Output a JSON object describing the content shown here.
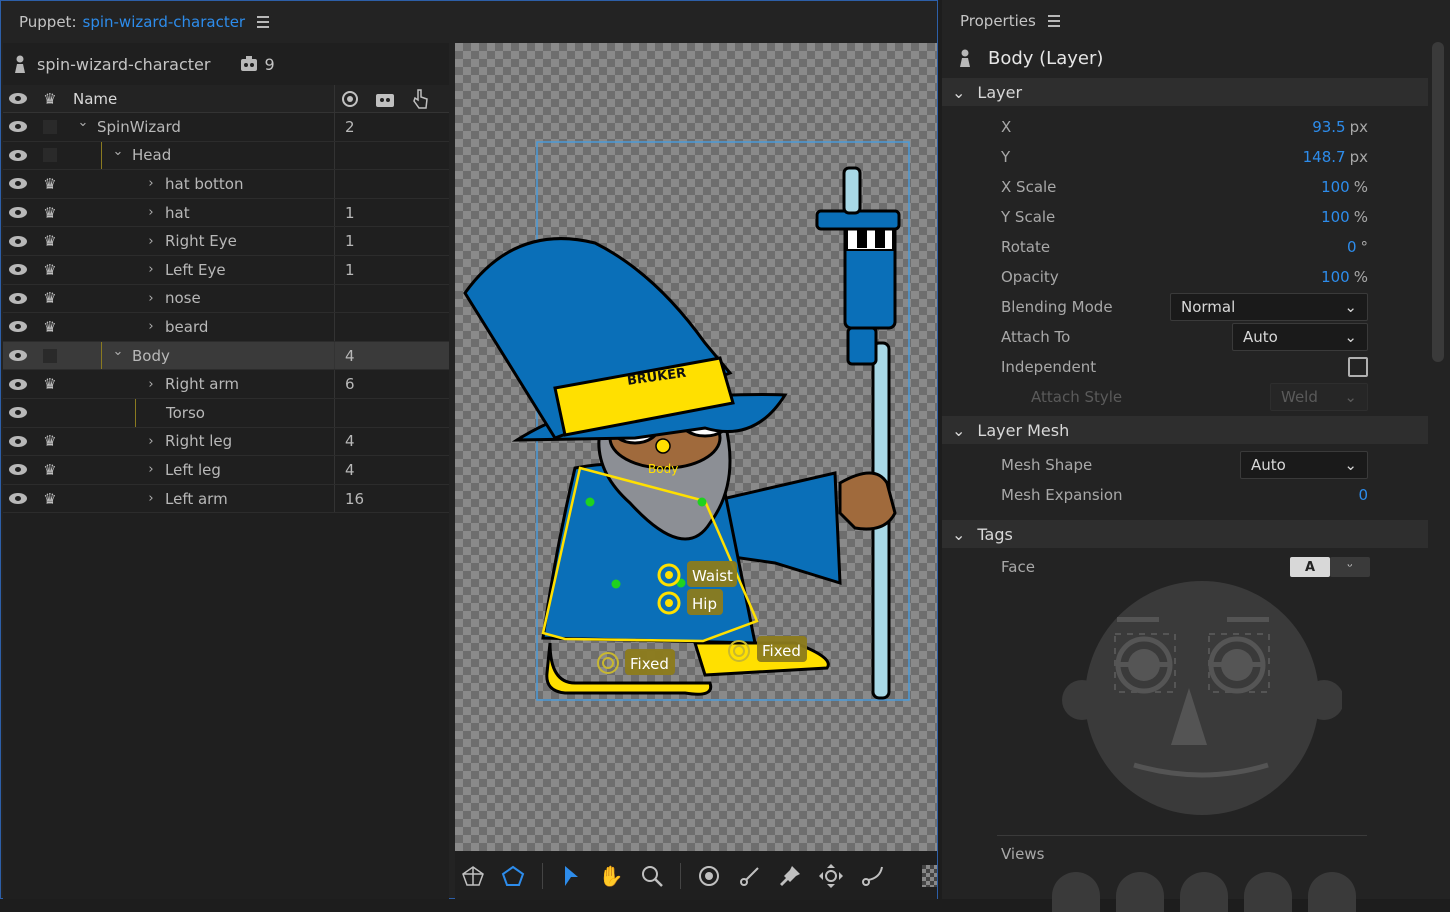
{
  "puppet_panel": {
    "title_prefix": "Puppet:",
    "title_name": "spin-wizard-character",
    "rig_name": "spin-wizard-character",
    "rig_count": "9",
    "columns": {
      "name": "Name"
    },
    "layers": [
      {
        "name": "SpinWizard",
        "count": "2",
        "indent": 0,
        "chevron": "down",
        "crown": false,
        "square": true,
        "yline": false
      },
      {
        "name": "Head",
        "count": "",
        "indent": 1,
        "chevron": "down",
        "crown": false,
        "square": true,
        "yline": true
      },
      {
        "name": "hat botton",
        "count": "",
        "indent": 2,
        "chevron": "right",
        "crown": true,
        "square": false,
        "yline": false
      },
      {
        "name": "hat",
        "count": "1",
        "indent": 2,
        "chevron": "right",
        "crown": true,
        "square": false,
        "yline": false
      },
      {
        "name": "Right Eye",
        "count": "1",
        "indent": 2,
        "chevron": "right",
        "crown": true,
        "square": false,
        "yline": false
      },
      {
        "name": "Left Eye",
        "count": "1",
        "indent": 2,
        "chevron": "right",
        "crown": true,
        "square": false,
        "yline": false
      },
      {
        "name": "nose",
        "count": "",
        "indent": 2,
        "chevron": "right",
        "crown": true,
        "square": false,
        "yline": false
      },
      {
        "name": "beard",
        "count": "",
        "indent": 2,
        "chevron": "right",
        "crown": true,
        "square": false,
        "yline": false
      },
      {
        "name": "Body",
        "count": "4",
        "indent": 1,
        "chevron": "down",
        "crown": false,
        "square": true,
        "yline": true,
        "selected": true
      },
      {
        "name": "Right arm",
        "count": "6",
        "indent": 2,
        "chevron": "right",
        "crown": true,
        "square": false,
        "yline": false
      },
      {
        "name": "Torso",
        "count": "",
        "indent": 2,
        "chevron": "",
        "crown": false,
        "square": false,
        "yline": true
      },
      {
        "name": "Right leg",
        "count": "4",
        "indent": 2,
        "chevron": "right",
        "crown": true,
        "square": false,
        "yline": false
      },
      {
        "name": "Left leg",
        "count": "4",
        "indent": 2,
        "chevron": "right",
        "crown": true,
        "square": false,
        "yline": false
      },
      {
        "name": "Left arm",
        "count": "16",
        "indent": 2,
        "chevron": "right",
        "crown": true,
        "square": false,
        "yline": false
      }
    ]
  },
  "stage": {
    "hat_text": "BRUKER",
    "body_label": "Body",
    "handles": {
      "waist": "Waist",
      "hip": "Hip",
      "fixed1": "Fixed",
      "fixed2": "Fixed"
    }
  },
  "properties": {
    "title": "Properties",
    "layer_name": "Body (Layer)",
    "section_layer": "Layer",
    "x": {
      "label": "X",
      "value": "93.5",
      "unit": "px"
    },
    "y": {
      "label": "Y",
      "value": "148.7",
      "unit": "px"
    },
    "xscale": {
      "label": "X Scale",
      "value": "100",
      "unit": "%"
    },
    "yscale": {
      "label": "Y Scale",
      "value": "100",
      "unit": "%"
    },
    "rotate": {
      "label": "Rotate",
      "value": "0",
      "unit": "°"
    },
    "opacity": {
      "label": "Opacity",
      "value": "100",
      "unit": "%"
    },
    "blending": {
      "label": "Blending Mode",
      "value": "Normal"
    },
    "attach_to": {
      "label": "Attach To",
      "value": "Auto"
    },
    "independent": {
      "label": "Independent"
    },
    "attach_style": {
      "label": "Attach Style",
      "value": "Weld"
    },
    "section_mesh": "Layer Mesh",
    "mesh_shape": {
      "label": "Mesh Shape",
      "value": "Auto"
    },
    "mesh_expansion": {
      "label": "Mesh Expansion",
      "value": "0"
    },
    "section_tags": "Tags",
    "face": {
      "label": "Face",
      "toggle_a": "A"
    },
    "views": {
      "label": "Views"
    }
  },
  "colors": {
    "accent": "#2d8ceb",
    "selected_row": "#3a3a3a"
  }
}
